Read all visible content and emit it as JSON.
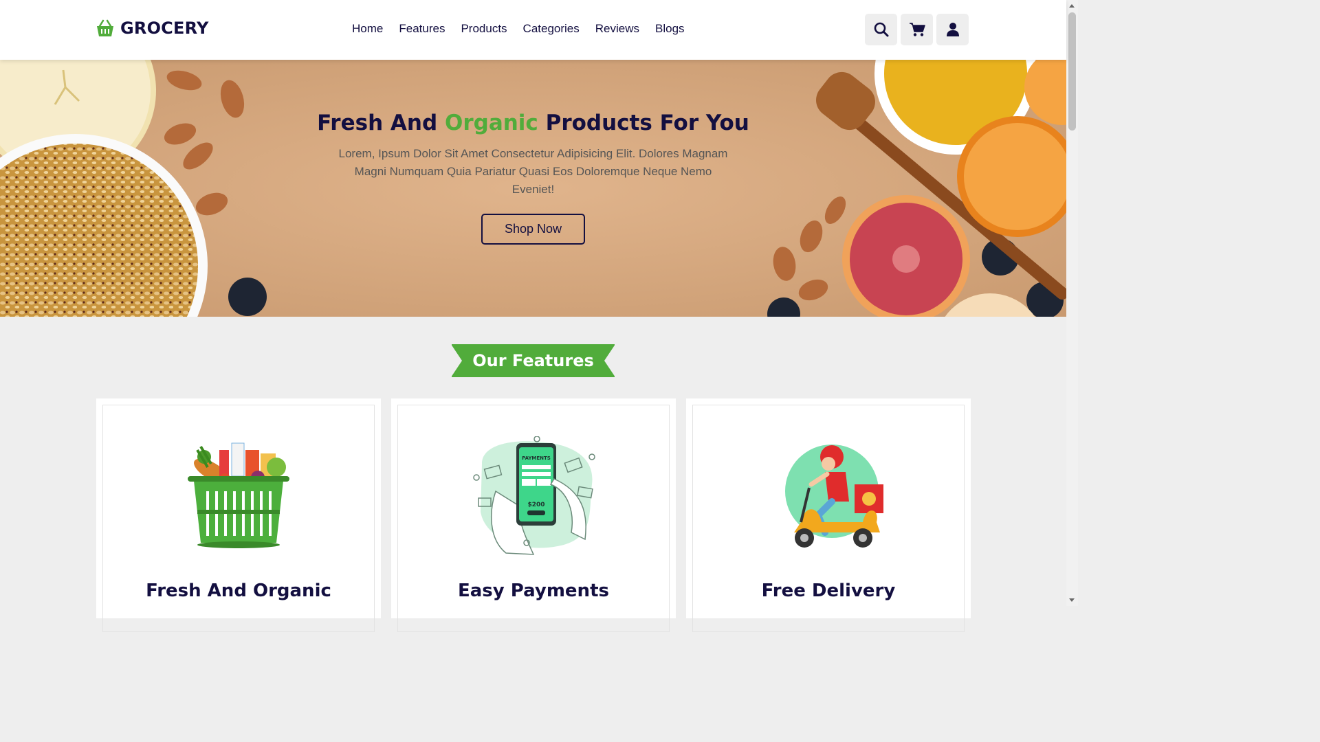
{
  "brand": {
    "name": "GROCERY",
    "accent": "#51ac3b",
    "dark": "#130f40"
  },
  "nav": {
    "items": [
      "Home",
      "Features",
      "Products",
      "Categories",
      "Reviews",
      "Blogs"
    ]
  },
  "header_icons": [
    "search-icon",
    "cart-icon",
    "user-icon"
  ],
  "hero": {
    "title_pre": "Fresh And ",
    "title_accent": "Organic",
    "title_post": " Products For You",
    "description": "Lorem, Ipsum Dolor Sit Amet Consectetur Adipisicing Elit. Dolores Magnam Magni Numquam Quia Pariatur Quasi Eos Doloremque Neque Nemo Eveniet!",
    "button": "Shop Now"
  },
  "features": {
    "heading": "Our Features",
    "cards": [
      {
        "title": "Fresh And Organic",
        "icon": "grocery-basket-icon"
      },
      {
        "title": "Easy Payments",
        "icon": "mobile-payment-icon"
      },
      {
        "title": "Free Delivery",
        "icon": "delivery-scooter-icon"
      }
    ]
  },
  "payment_illustration": {
    "header": "PAYMENTS",
    "amount": "$200"
  }
}
